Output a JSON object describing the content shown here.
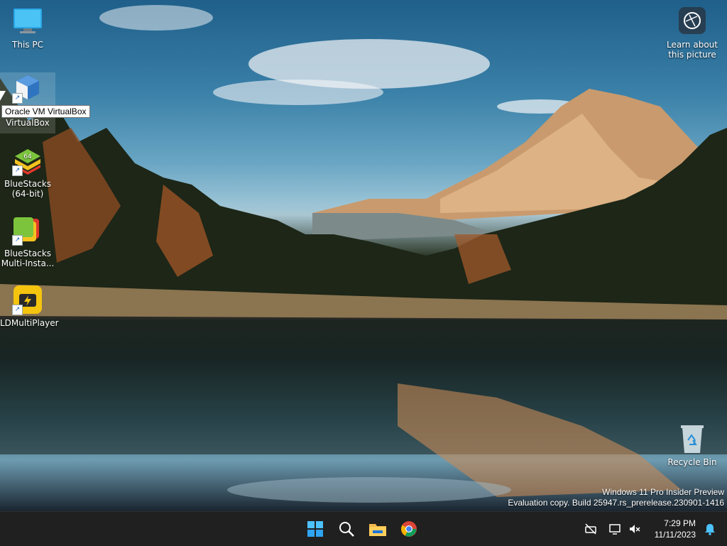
{
  "desktop": {
    "icons": [
      {
        "label": "This PC"
      },
      {
        "label": "VirtualBox",
        "tooltip": "Oracle VM VirtualBox"
      },
      {
        "label": "BlueStacks (64-bit)",
        "badge": "64"
      },
      {
        "label": "BlueStacks Multi-Insta..."
      },
      {
        "label": "LDMultiPlayer"
      }
    ],
    "recycle_bin": {
      "label": "Recycle Bin"
    },
    "learn_picture": {
      "label": "Learn about this picture"
    }
  },
  "watermark": {
    "line1": "Windows 11 Pro Insider Preview",
    "line2": "Evaluation copy. Build 25947.rs_prerelease.230901-1416"
  },
  "taskbar": {
    "apps": [
      "start-icon",
      "search-icon",
      "file-explorer-icon",
      "chrome-icon"
    ],
    "clock": {
      "time": "7:29 PM",
      "date": "11/11/2023"
    },
    "tray_icons": [
      "network-off-icon",
      "display-icon",
      "volume-muted-icon",
      "notification-bell-icon"
    ]
  },
  "colors": {
    "taskbar_bg": "#202020",
    "accent": "#0078d4"
  }
}
